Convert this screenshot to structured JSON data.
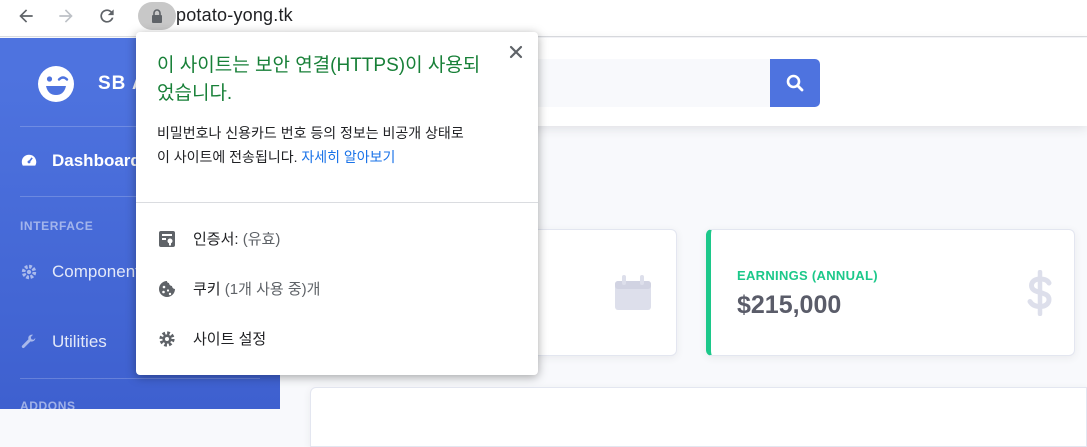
{
  "browser": {
    "url": "potato-yong.tk"
  },
  "sidebar": {
    "brand": "SB A",
    "items": [
      {
        "label": "Dashboard"
      },
      {
        "label": "Components"
      },
      {
        "label": "Utilities"
      }
    ],
    "headings": [
      "INTERFACE",
      "ADDONS"
    ]
  },
  "cards": {
    "annual": {
      "label": "EARNINGS (ANNUAL)",
      "value": "$215,000"
    }
  },
  "security_popup": {
    "title": "이 사이트는 보안 연결(HTTPS)이 사용되었습니다.",
    "description": "비밀번호나 신용카드 번호 등의 정보는 비공개 상태로 이 사이트에 전송됩니다.",
    "learn_more": "자세히 알아보기",
    "certificate_label": "인증서:",
    "certificate_status": "(유효)",
    "cookies_label": "쿠키",
    "cookies_status": "(1개 사용 중)개",
    "site_settings": "사이트 설정"
  },
  "colors": {
    "primary": "#4e73df",
    "success": "#1cc88a",
    "secure_green": "#188038",
    "link_blue": "#1a73e8"
  }
}
